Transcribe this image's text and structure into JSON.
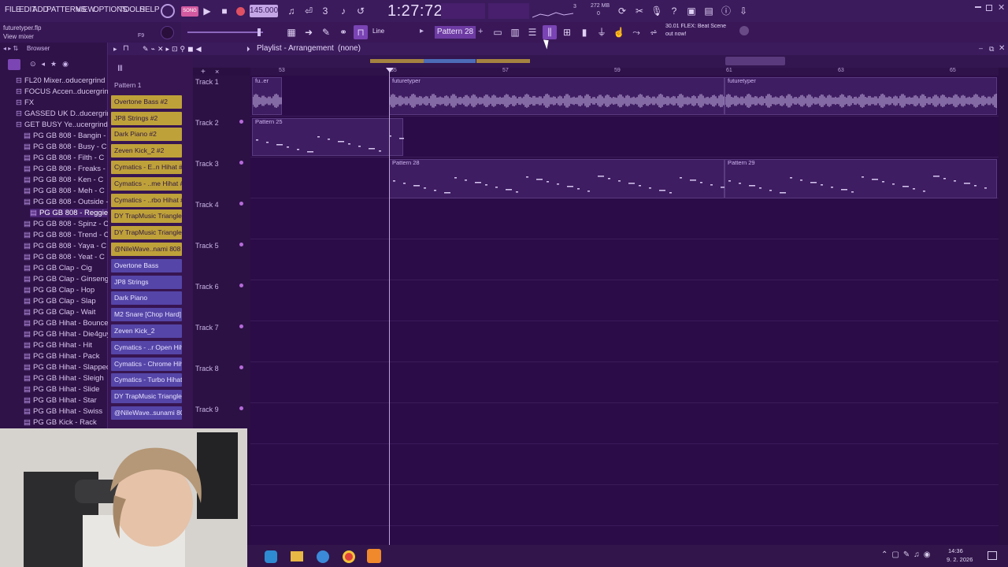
{
  "menu": [
    "FILE",
    "EDIT",
    "ADD",
    "PATTERNS",
    "VIEW",
    "OPTIONS",
    "TOOLS",
    "HELP"
  ],
  "transport": {
    "bpm": "145.000",
    "time": "1:27:72",
    "song_label": "SONG",
    "mem": "272 MB",
    "voices": "3",
    "cpu": "0"
  },
  "hint": {
    "file": "futuretyper.flp",
    "line2": "View mixer",
    "shortcut": "F9"
  },
  "toolbar2": {
    "snap": "Line",
    "pattern": "Pattern 28"
  },
  "news": {
    "line1": "30.01 FLEX: Beat Scene",
    "line2": "out now!"
  },
  "playlist": {
    "title": "Playlist - Arrangement",
    "arrangement": "(none)",
    "browser_label": "Browser"
  },
  "ruler": [
    "53",
    "55",
    "57",
    "59",
    "61",
    "63",
    "65"
  ],
  "browser_items": [
    {
      "label": "FL20 Mixer..oducergrind",
      "indent": 1
    },
    {
      "label": "FOCUS Accen..ducergrind",
      "indent": 1
    },
    {
      "label": "FX",
      "indent": 1
    },
    {
      "label": "GASSED UK D..ducergrind",
      "indent": 1
    },
    {
      "label": "GET BUSY Ye..ucergrind",
      "indent": 1
    },
    {
      "label": "PG GB 808 - Bangin - C",
      "indent": 2
    },
    {
      "label": "PG GB 808 - Busy - C",
      "indent": 2
    },
    {
      "label": "PG GB 808 - Filth - C",
      "indent": 2
    },
    {
      "label": "PG GB 808 - Freaks - C",
      "indent": 2
    },
    {
      "label": "PG GB 808 - Ken - C",
      "indent": 2
    },
    {
      "label": "PG GB 808 - Meh - C",
      "indent": 2
    },
    {
      "label": "PG GB 808 - Outside - C",
      "indent": 2
    },
    {
      "label": "PG GB 808 - Reggie - C",
      "indent": 3
    },
    {
      "label": "PG GB 808 - Spinz - C",
      "indent": 2
    },
    {
      "label": "PG GB 808 - Trend - C",
      "indent": 2
    },
    {
      "label": "PG GB 808 - Yaya - C",
      "indent": 2
    },
    {
      "label": "PG GB 808 - Yeat - C",
      "indent": 2
    },
    {
      "label": "PG GB Clap - Cig",
      "indent": 2
    },
    {
      "label": "PG GB Clap - Ginseng",
      "indent": 2
    },
    {
      "label": "PG GB Clap - Hop",
      "indent": 2
    },
    {
      "label": "PG GB Clap - Slap",
      "indent": 2
    },
    {
      "label": "PG GB Clap - Wait",
      "indent": 2
    },
    {
      "label": "PG GB Hihat - Bounce",
      "indent": 2
    },
    {
      "label": "PG GB Hihat - Die4guy",
      "indent": 2
    },
    {
      "label": "PG GB Hihat - Hit",
      "indent": 2
    },
    {
      "label": "PG GB Hihat - Pack",
      "indent": 2
    },
    {
      "label": "PG GB Hihat - Slapped",
      "indent": 2
    },
    {
      "label": "PG GB Hihat - Sleigh",
      "indent": 2
    },
    {
      "label": "PG GB Hihat - Slide",
      "indent": 2
    },
    {
      "label": "PG GB Hihat - Star",
      "indent": 2
    },
    {
      "label": "PG GB Hihat - Swiss",
      "indent": 2
    },
    {
      "label": "PG GB Kick - Rack",
      "indent": 2
    }
  ],
  "channels": [
    {
      "label": "Pattern 1",
      "color": "none"
    },
    {
      "label": "Overtone Bass #2",
      "color": "y"
    },
    {
      "label": "JP8 Strings #2",
      "color": "y"
    },
    {
      "label": "Dark Piano #2",
      "color": "y"
    },
    {
      "label": "Zeven Kick_2 #2",
      "color": "y"
    },
    {
      "label": "Cymatics - E..n Hihat #2",
      "color": "y"
    },
    {
      "label": "Cymatics - ..me Hihat #2",
      "color": "y"
    },
    {
      "label": "Cymatics - ..rbo Hihat #2",
      "color": "y"
    },
    {
      "label": "DY TrapMusic Triangle #3",
      "color": "y"
    },
    {
      "label": "DY TrapMusic Triangle #2",
      "color": "y"
    },
    {
      "label": "@NileWave..nami 808 #2",
      "color": "y"
    },
    {
      "label": "Overtone Bass",
      "color": "b"
    },
    {
      "label": "JP8 Strings",
      "color": "b"
    },
    {
      "label": "Dark Piano",
      "color": "b"
    },
    {
      "label": "M2 Snare [Chop Hard]",
      "color": "b"
    },
    {
      "label": "Zeven Kick_2",
      "color": "b"
    },
    {
      "label": "Cymatics - ..r Open Hihat",
      "color": "b"
    },
    {
      "label": "Cymatics - Chrome Hihat",
      "color": "b"
    },
    {
      "label": "Cymatics - Turbo Hihat",
      "color": "b"
    },
    {
      "label": "DY TrapMusic Triangle",
      "color": "b"
    },
    {
      "label": "@NileWave..sunami 808",
      "color": "b"
    }
  ],
  "tracks": [
    "Track 1",
    "Track 2",
    "Track 3",
    "Track 4",
    "Track 5",
    "Track 6",
    "Track 7",
    "Track 8",
    "Track 9"
  ],
  "clips": [
    {
      "label": "fu..er",
      "lane": 0
    },
    {
      "label": "futuretyper",
      "lane": 0
    },
    {
      "label": "futuretyper",
      "lane": 0
    },
    {
      "label": "Pattern 25",
      "lane": 1
    },
    {
      "label": "Pattern 28",
      "lane": 2
    },
    {
      "label": "Pattern 29",
      "lane": 2
    }
  ],
  "clock": {
    "time": "14:36",
    "date": "9. 2. 2026"
  }
}
